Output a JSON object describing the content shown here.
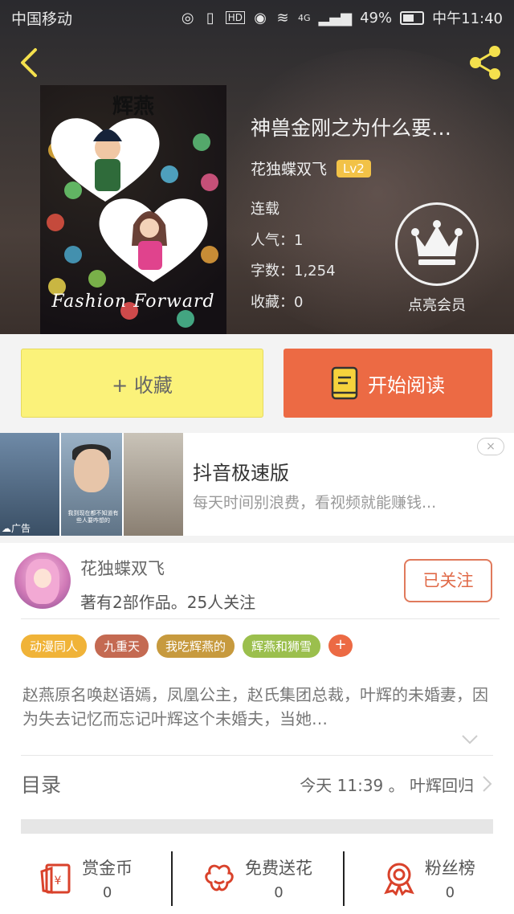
{
  "status_bar": {
    "carrier": "中国移动",
    "network": "4G",
    "battery": "49%",
    "time": "中午11:40",
    "icons": [
      "sim-icon",
      "vibrate-icon",
      "hd-icon",
      "eye-icon",
      "wifi-icon",
      "signal-icon",
      "battery-icon"
    ]
  },
  "book": {
    "cover_title": "辉燕",
    "cover_subtitle": "Fashion Forward",
    "title": "神兽金刚之为什么要…",
    "author": "花独蝶双飞",
    "level": "Lv2",
    "status": "连载",
    "popularity": "人气：1",
    "word_count": "字数：1,254",
    "favorites": "收藏：0",
    "vip_label": "点亮会员"
  },
  "actions": {
    "collect": "+ 收藏",
    "start_reading": "开始阅读"
  },
  "ad": {
    "title": "抖音极速版",
    "description": "每天时间别浪费，看视频就能赚钱...",
    "tag": "广告",
    "caption": "我到现在都不知道有些人要咋想的",
    "close": "×"
  },
  "author_card": {
    "name": "花独蝶双飞",
    "stats": "著有2部作品。25人关注",
    "follow": "已关注",
    "tags": [
      {
        "label": "动漫同人",
        "color": "#f0b338"
      },
      {
        "label": "九重天",
        "color": "#c46a52"
      },
      {
        "label": "我吃辉燕的",
        "color": "#c79a3e"
      },
      {
        "label": "辉燕和狮雪",
        "color": "#9bbf4d"
      }
    ],
    "tag_add": "+",
    "description": "赵燕原名唤赵语嫣，凤凰公主，赵氏集团总裁，叶辉的未婚妻，因为失去记忆而忘记叶辉这个未婚夫，当她…",
    "toc_label": "目录",
    "toc_latest": "今天 11:39 。 叶辉回归"
  },
  "bottom_actions": [
    {
      "label": "赏金币",
      "count": "0",
      "icon": "coin-envelope-icon"
    },
    {
      "label": "免费送花",
      "count": "0",
      "icon": "flower-icon"
    },
    {
      "label": "粉丝榜",
      "count": "0",
      "icon": "medal-icon"
    }
  ],
  "colors": {
    "accent_orange": "#ec6a44",
    "collect_yellow": "#fbf27a",
    "level_badge": "#f2c247",
    "icon_red": "#d9422b"
  }
}
